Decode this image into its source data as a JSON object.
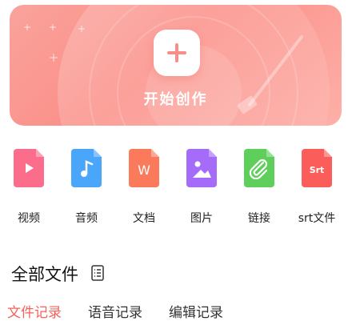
{
  "banner": {
    "create_label": "开始创作"
  },
  "tools": [
    {
      "label": "视频",
      "icon": "play-icon",
      "color": "#fb6d8b"
    },
    {
      "label": "音频",
      "icon": "music-note-icon",
      "color": "#4aa6fb"
    },
    {
      "label": "文档",
      "icon": "word-w-icon",
      "color": "#fb7a5c",
      "glyph": "W"
    },
    {
      "label": "图片",
      "icon": "image-icon",
      "color": "#a56cfa"
    },
    {
      "label": "链接",
      "icon": "paperclip-icon",
      "color": "#5fcf5b"
    },
    {
      "label": "srt文件",
      "icon": "srt-icon",
      "color": "#fb5e5a",
      "glyph": "Srt"
    }
  ],
  "section": {
    "title": "全部文件"
  },
  "tabs": [
    {
      "label": "文件记录",
      "active": true
    },
    {
      "label": "语音记录",
      "active": false
    },
    {
      "label": "编辑记录",
      "active": false
    }
  ],
  "colors": {
    "accent": "#f4615a",
    "banner": "#fb8e87"
  }
}
